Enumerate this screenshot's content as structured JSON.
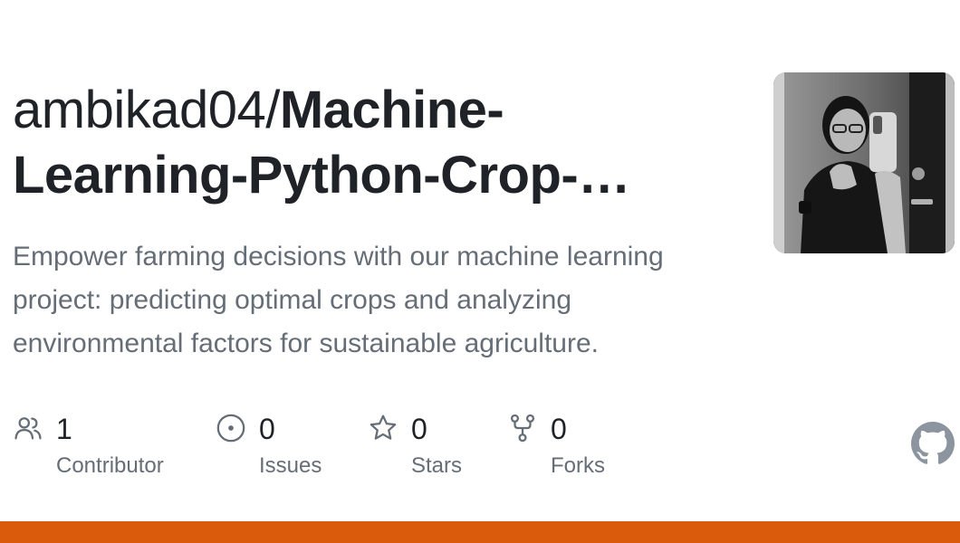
{
  "repo": {
    "owner": "ambikad04/",
    "name": "Machine-Learning-Python-Crop-…",
    "description": "Empower farming decisions with our machine learning project: predicting optimal crops and analyzing environmental factors for sustainable agriculture."
  },
  "stats": [
    {
      "icon": "people-icon",
      "count": "1",
      "label": "Contributor"
    },
    {
      "icon": "issue-opened-icon",
      "count": "0",
      "label": "Issues"
    },
    {
      "icon": "star-icon",
      "count": "0",
      "label": "Stars"
    },
    {
      "icon": "repo-forked-icon",
      "count": "0",
      "label": "Forks"
    }
  ],
  "icons": {
    "logo": "github-mark-icon"
  },
  "colors": {
    "language_bar": "#DA5B0B",
    "title_text": "#1F2328",
    "muted_text": "#656D76"
  }
}
